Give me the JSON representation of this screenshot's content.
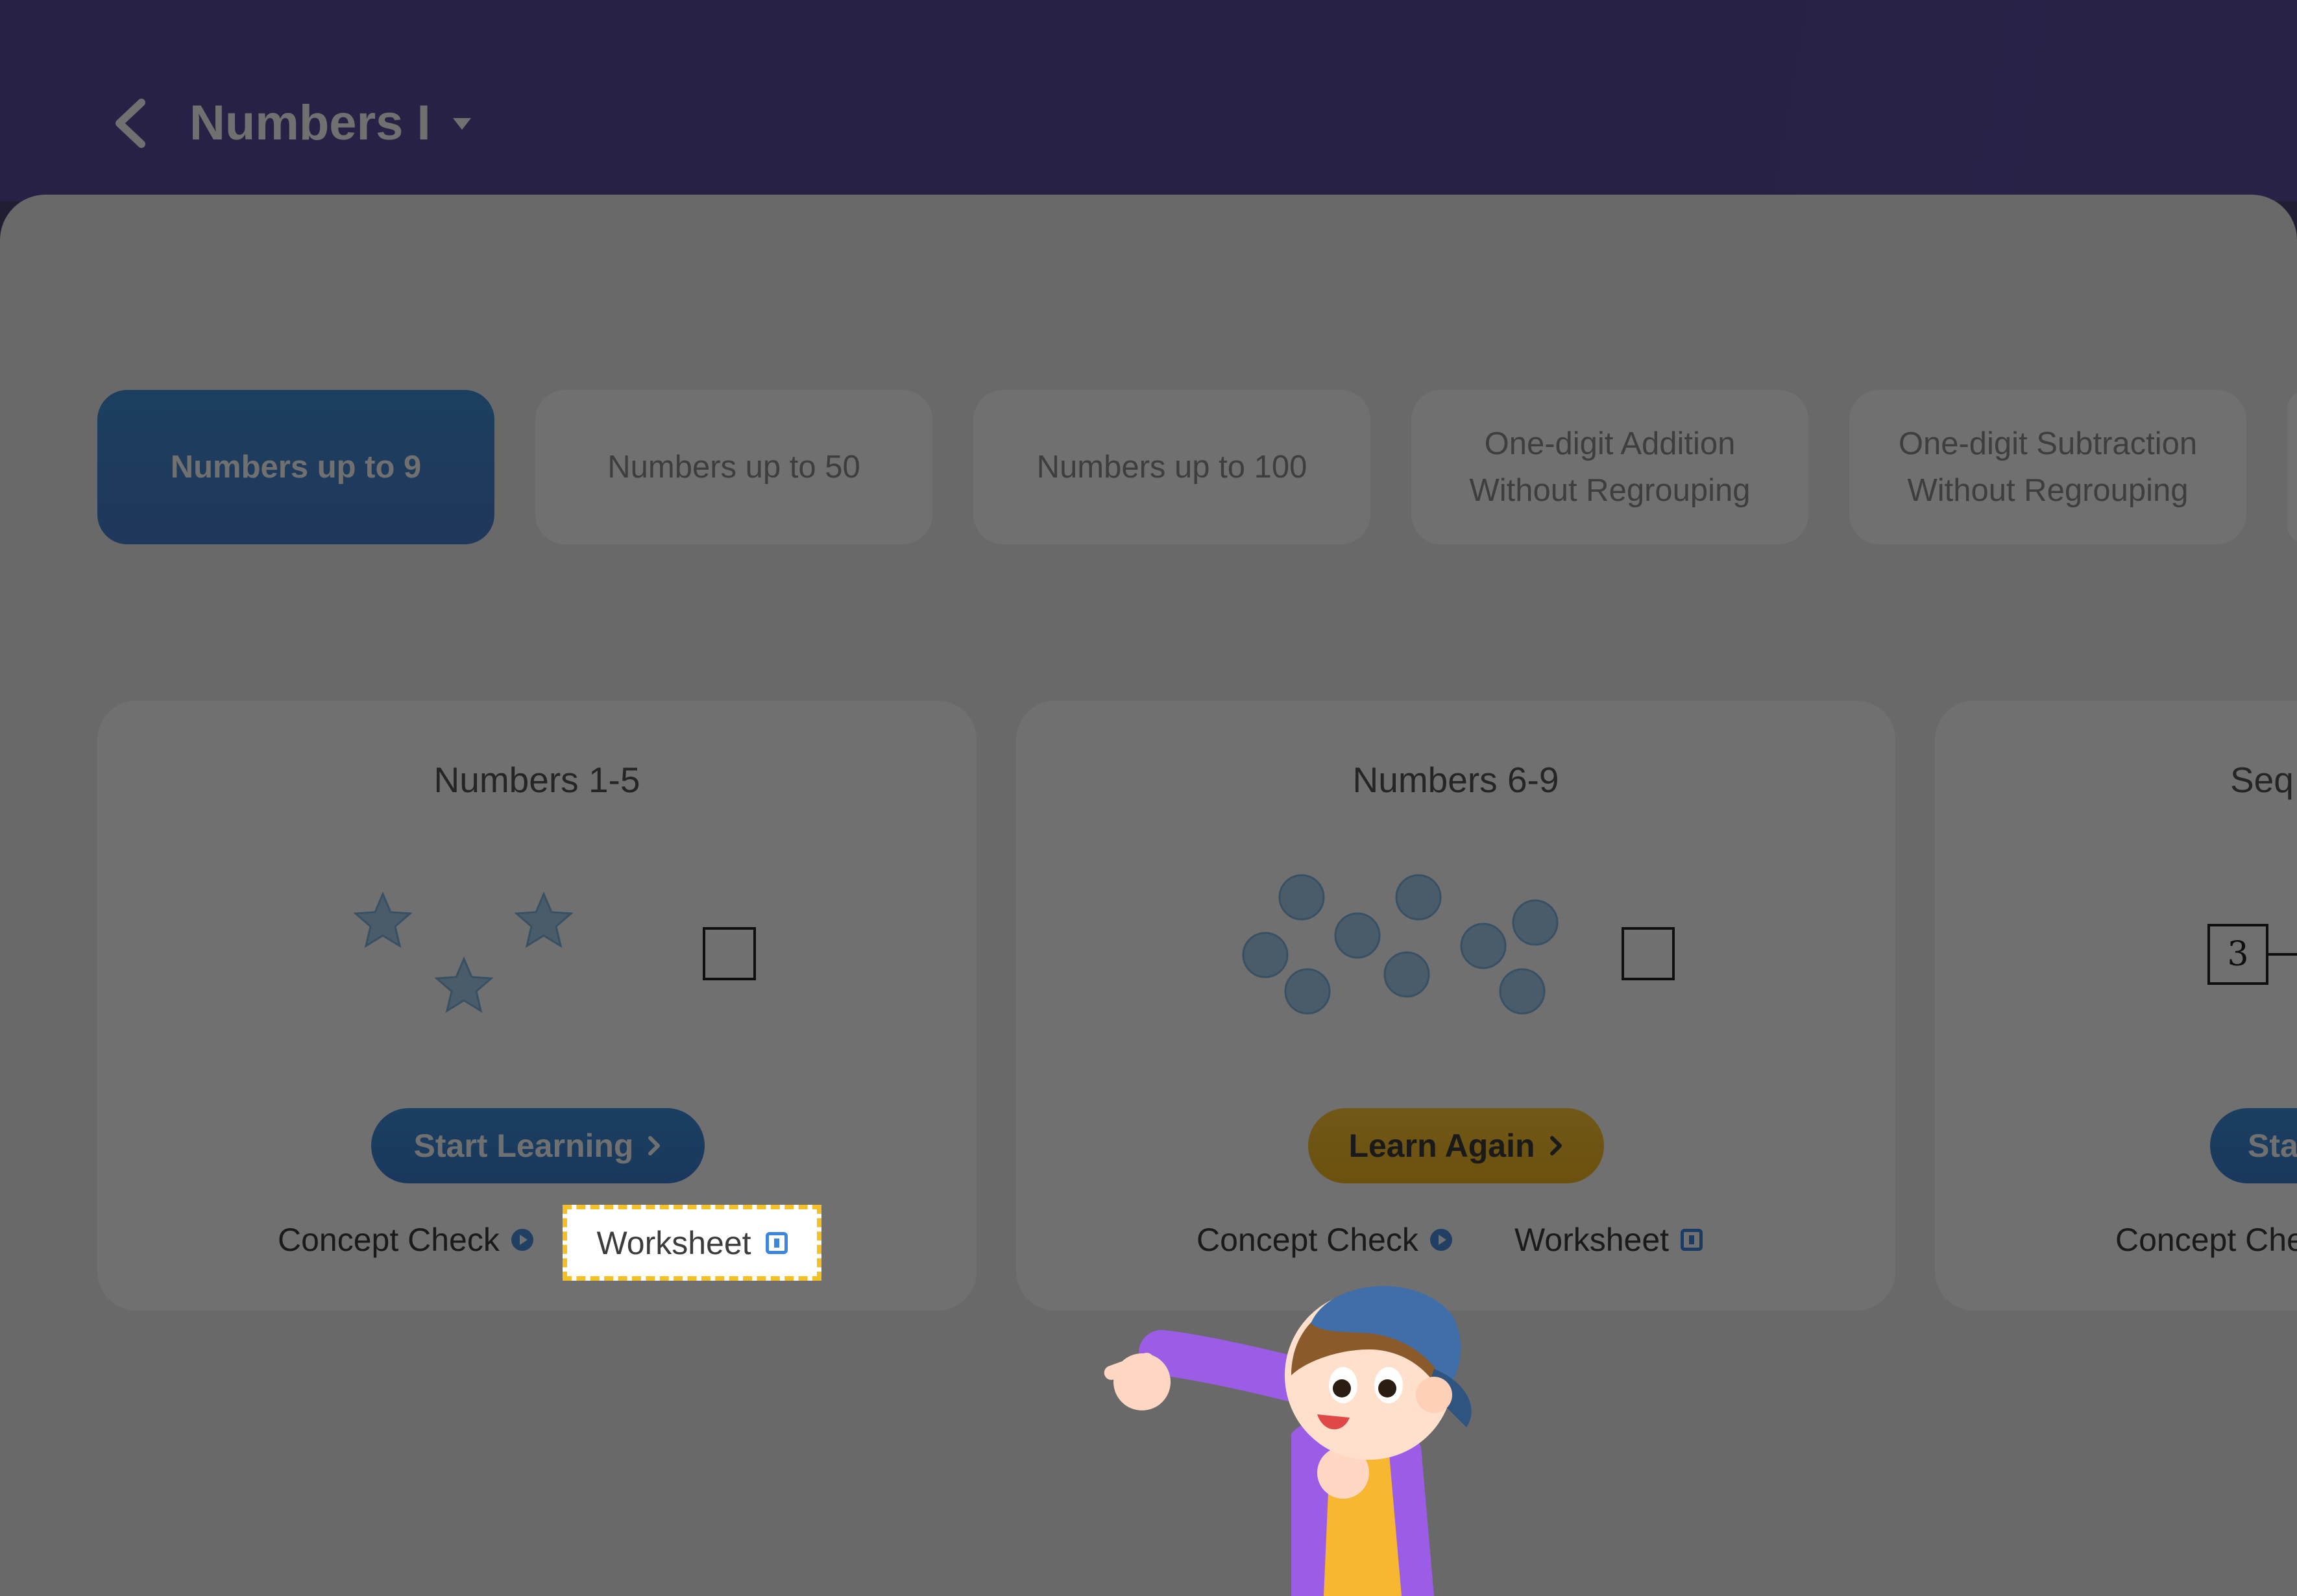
{
  "header": {
    "title": "Numbers I",
    "back_icon": "chevron-left-icon",
    "dropdown_icon": "caret-down-icon"
  },
  "tabs": [
    {
      "label": "Numbers up to 9",
      "active": true
    },
    {
      "label": "Numbers up to 50",
      "active": false
    },
    {
      "label": "Numbers up to 100",
      "active": false
    },
    {
      "label": "One-digit Addition\nWithout Regrouping",
      "active": false
    },
    {
      "label": "One-digit Subtraction\nWithout Regrouping",
      "active": false
    }
  ],
  "cards": [
    {
      "title": "Numbers 1-5",
      "button": "Start Learning",
      "concept_check": "Concept Check",
      "worksheet": "Worksheet"
    },
    {
      "title": "Numbers 6-9",
      "button": "Learn Again",
      "concept_check": "Concept Check",
      "worksheet": "Worksheet"
    },
    {
      "title": "Seq",
      "number": "3",
      "button": "Sta",
      "concept_check": "Concept Che"
    }
  ],
  "highlight": {
    "label": "Worksheet"
  },
  "colors": {
    "header": "#574c9c",
    "accent_blue": "#3f8fd9",
    "accent_yellow": "#ffc93a",
    "highlight_border": "#f5c024"
  }
}
